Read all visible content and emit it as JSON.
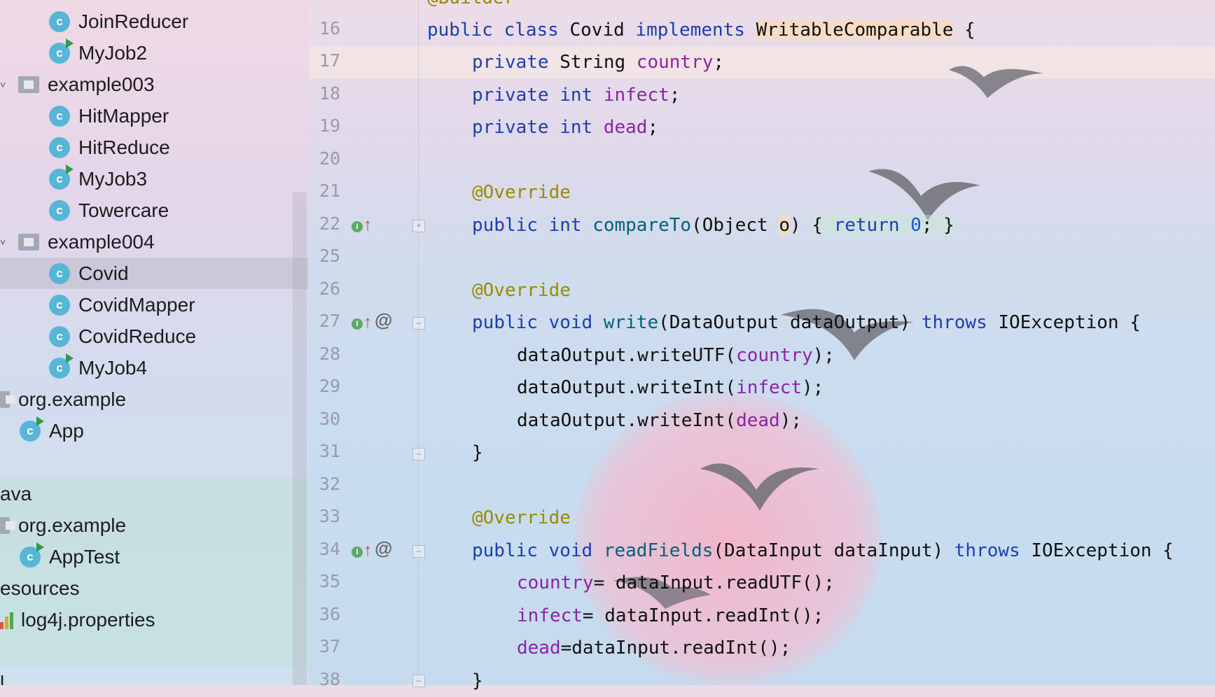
{
  "tree": {
    "items": [
      {
        "label": "JoinReducer",
        "icon": "class-icon",
        "runnable": false
      },
      {
        "label": "MyJob2",
        "icon": "runnable-class-icon",
        "runnable": true
      },
      {
        "label": "example003",
        "icon": "package-folder-icon"
      },
      {
        "label": "HitMapper",
        "icon": "class-icon",
        "runnable": false
      },
      {
        "label": "HitReduce",
        "icon": "class-icon",
        "runnable": false
      },
      {
        "label": "MyJob3",
        "icon": "runnable-class-icon",
        "runnable": true
      },
      {
        "label": "Towercare",
        "icon": "class-icon",
        "runnable": false
      },
      {
        "label": "example004",
        "icon": "package-folder-icon"
      },
      {
        "label": "Covid",
        "icon": "class-icon",
        "runnable": false,
        "selected": true
      },
      {
        "label": "CovidMapper",
        "icon": "class-icon",
        "runnable": false
      },
      {
        "label": "CovidReduce",
        "icon": "class-icon",
        "runnable": false
      },
      {
        "label": "MyJob4",
        "icon": "runnable-class-icon",
        "runnable": true
      },
      {
        "label": "org.example",
        "icon": "package-folder-icon"
      },
      {
        "label": "App",
        "icon": "runnable-class-icon",
        "runnable": true
      },
      {
        "label": "ava",
        "icon": ""
      },
      {
        "label": "org.example",
        "icon": "package-folder-icon"
      },
      {
        "label": "AppTest",
        "icon": "runnable-class-icon",
        "runnable": true
      },
      {
        "label": "esources",
        "icon": ""
      },
      {
        "label": "log4j.properties",
        "icon": "properties-file-icon"
      },
      {
        "label": "l",
        "icon": ""
      }
    ]
  },
  "editor": {
    "lines": [
      {
        "num": "16"
      },
      {
        "num": "17"
      },
      {
        "num": "18"
      },
      {
        "num": "19"
      },
      {
        "num": "20"
      },
      {
        "num": "21"
      },
      {
        "num": "22"
      },
      {
        "num": "25"
      },
      {
        "num": "26"
      },
      {
        "num": "27"
      },
      {
        "num": "28"
      },
      {
        "num": "29"
      },
      {
        "num": "30"
      },
      {
        "num": "31"
      },
      {
        "num": "32"
      },
      {
        "num": "33"
      },
      {
        "num": "34"
      },
      {
        "num": "35"
      },
      {
        "num": "36"
      },
      {
        "num": "37"
      },
      {
        "num": "38"
      }
    ],
    "code": {
      "l15": "@Builder",
      "l16_a": "public class ",
      "l16_b": "Covid ",
      "l16_c": "implements ",
      "l16_d": "WritableComparable",
      "l16_e": " {",
      "l17_a": "private ",
      "l17_b": "String ",
      "l17_c": "country",
      "l17_d": ";",
      "l18_a": "private int ",
      "l18_b": "infect",
      "l18_c": ";",
      "l19_a": "private int ",
      "l19_b": "dead",
      "l19_c": ";",
      "l21": "@Override",
      "l22_a": "public int ",
      "l22_b": "compareTo",
      "l22_c": "(Object ",
      "l22_d": "o",
      "l22_e": ") ",
      "l22_f": "{ ",
      "l22_g": "return ",
      "l22_h": "0",
      "l22_i": "; }",
      "l26": "@Override",
      "l27_a": "public void ",
      "l27_b": "write",
      "l27_c": "(DataOutput dataOutput) ",
      "l27_d": "throws ",
      "l27_e": "IOException {",
      "l28_a": "dataOutput.writeUTF(",
      "l28_b": "country",
      "l28_c": ");",
      "l29_a": "dataOutput.writeInt(",
      "l29_b": "infect",
      "l29_c": ");",
      "l30_a": "dataOutput.writeInt(",
      "l30_b": "dead",
      "l30_c": ");",
      "l31": "}",
      "l33": "@Override",
      "l34_a": "public void ",
      "l34_b": "readFields",
      "l34_c": "(DataInput dataInput) ",
      "l34_d": "throws ",
      "l34_e": "IOException {",
      "l35_a": "country",
      "l35_b": "= dataInput.readUTF();",
      "l36_a": "infect",
      "l36_b": "= dataInput.readInt();",
      "l37_a": "dead",
      "l37_b": "=dataInput.readInt();",
      "l38": "}"
    },
    "gutter_icons": {
      "implements": "implementing-method-icon",
      "at": "@"
    }
  },
  "colors": {
    "keyword": "#1c3fb0",
    "field": "#8a24a8",
    "annotation": "#9b8a00",
    "method": "#00627a",
    "number": "#1750eb"
  }
}
